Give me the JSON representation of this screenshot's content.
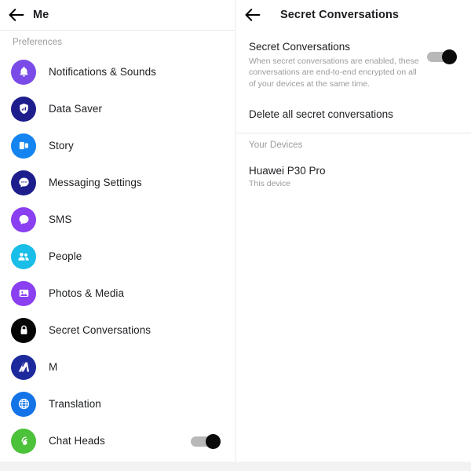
{
  "left_panel": {
    "header": {
      "back_icon": "arrow-left-icon",
      "title": "Me"
    },
    "section_label": "Preferences",
    "items": [
      {
        "label": "Notifications & Sounds",
        "icon": "bell-icon",
        "color": "#7B4BE8",
        "toggle": null
      },
      {
        "label": "Data Saver",
        "icon": "shield-signal-icon",
        "color": "#1D1E8C",
        "toggle": null
      },
      {
        "label": "Story",
        "icon": "story-cards-icon",
        "color": "#1484F0",
        "toggle": null
      },
      {
        "label": "Messaging Settings",
        "icon": "chat-bubble-icon",
        "color": "#1D1E8C",
        "toggle": null
      },
      {
        "label": "SMS",
        "icon": "sms-bubble-icon",
        "color": "#8A3FF0",
        "toggle": null
      },
      {
        "label": "People",
        "icon": "people-icon",
        "color": "#18BDE8",
        "toggle": null
      },
      {
        "label": "Photos & Media",
        "icon": "photo-icon",
        "color": "#8A3FF0",
        "toggle": null
      },
      {
        "label": "Secret Conversations",
        "icon": "lock-icon",
        "color": "#050505",
        "toggle": null
      },
      {
        "label": "M",
        "icon": "m-assistant-icon",
        "color": "#1D2A9C",
        "toggle": null
      },
      {
        "label": "Translation",
        "icon": "globe-icon",
        "color": "#1473E6",
        "toggle": null
      },
      {
        "label": "Chat Heads",
        "icon": "chat-heads-icon",
        "color": "#4CC13A",
        "toggle": "on"
      }
    ]
  },
  "right_panel": {
    "header": {
      "back_icon": "arrow-left-icon",
      "title": "Secret Conversations"
    },
    "secret_conversations": {
      "title": "Secret Conversations",
      "description": "When secret conversations are enabled, these conversations are end-to-end encrypted on all of your devices at the same time.",
      "toggle": "on"
    },
    "delete_action": "Delete all secret conversations",
    "devices_section_label": "Your Devices",
    "devices": [
      {
        "name": "Huawei P30 Pro",
        "subtitle": "This device"
      }
    ]
  },
  "colors": {
    "toggle_track": "#b8b8b8",
    "toggle_knob": "#0a0a0a",
    "text_primary": "#1c1e21",
    "text_muted": "#9a9a9a",
    "divider": "#e8e8e8"
  }
}
